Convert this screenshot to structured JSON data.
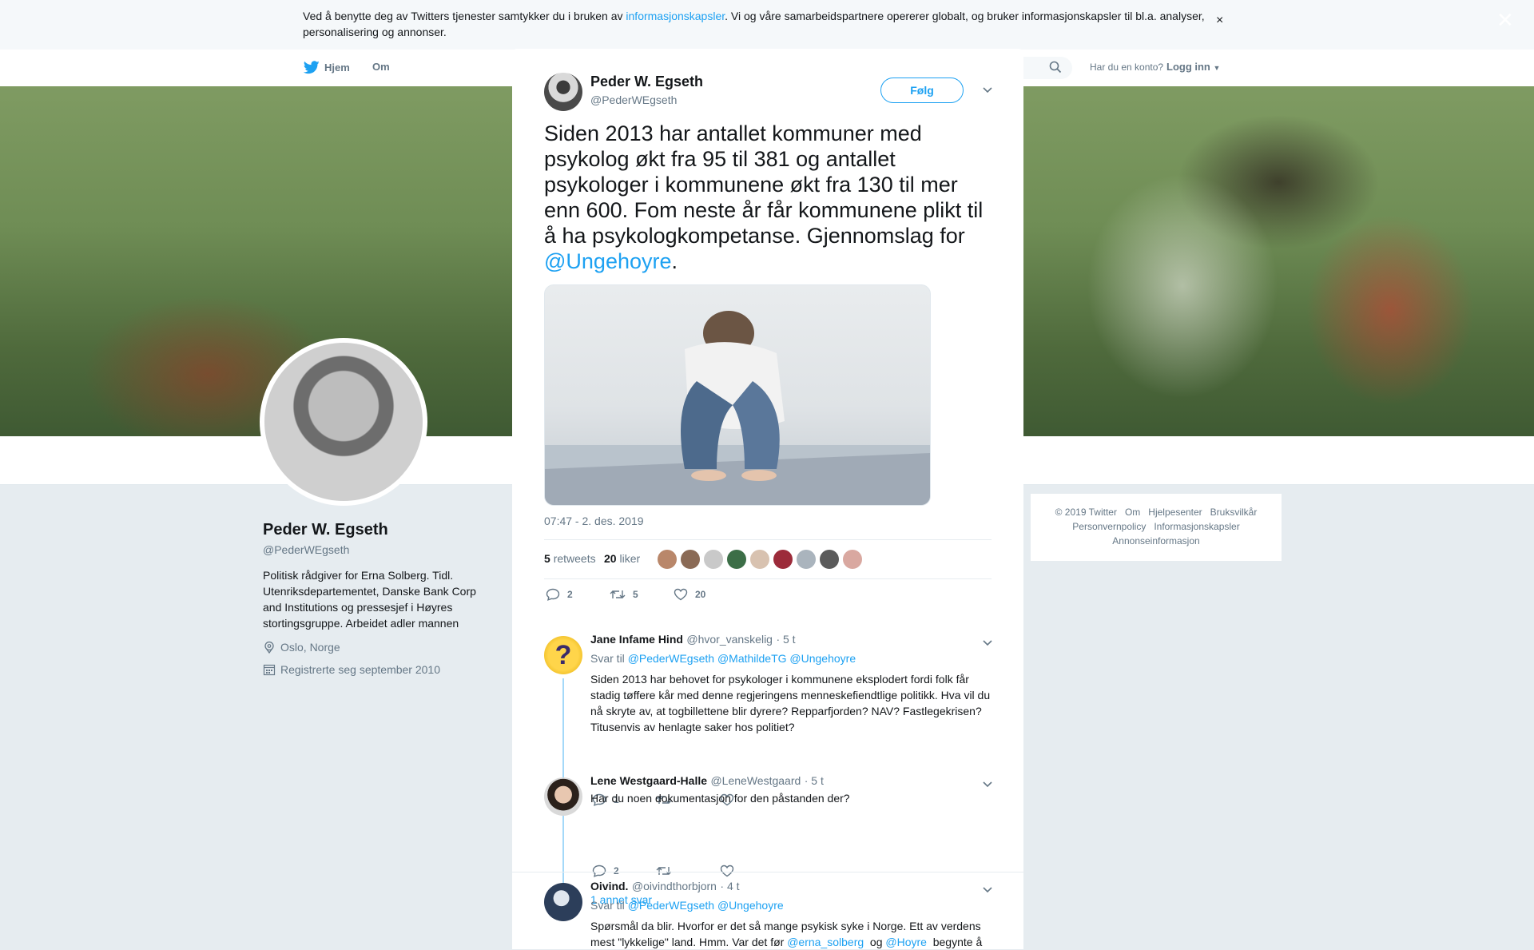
{
  "cookie_banner": {
    "text_before": "Ved å benytte deg av Twitters tjenester samtykker du i bruken av ",
    "link": "informasjonskapsler",
    "text_after": ". Vi og våre samarbeidspartnere opererer globalt, og bruker informasjonskapsler til bl.a. analyser, personalisering og annonser.",
    "close": "×"
  },
  "nav": {
    "home": "Hjem",
    "about": "Om",
    "account_question": "Har du en konto?",
    "login": "Logg inn"
  },
  "overlay_close": "✕",
  "profile": {
    "name": "Peder W. Egseth",
    "handle": "@PederWEgseth",
    "bio": "Politisk rådgiver for Erna Solberg. Tidl. Utenriksdepartementet, Danske Bank Corp and Institutions og pressesjef i Høyres stortingsgruppe. Arbeidet adler mannen",
    "location": "Oslo, Norge",
    "joined": "Registrerte seg september 2010"
  },
  "footer": {
    "links": [
      "© 2019 Twitter",
      "Om",
      "Hjelpesenter",
      "Bruksvilkår",
      "Personvernpolicy",
      "Informasjonskapsler",
      "Annonseinformasjon"
    ]
  },
  "tweet": {
    "author_name": "Peder W. Egseth",
    "author_handle": "@PederWEgseth",
    "follow": "Følg",
    "text_main": "Siden 2013 har antallet kommuner med psykolog økt fra 95 til 381 og antallet psykologer i kommunene økt fra 130 til mer enn 600. Fom neste år får kommunene plikt til å ha psykologkompetanse. Gjennomslag for ",
    "text_mention": "@Ungehoyre",
    "text_end": ".",
    "timestamp": "07:47 - 2. des. 2019",
    "retweets_count": "5",
    "retweets_label": "retweets",
    "likes_count": "20",
    "likes_label": "liker",
    "actions": {
      "replies": "2",
      "retweets": "5",
      "likes": "20"
    },
    "liker_colors": [
      "#b9876a",
      "#8a6a55",
      "#c9c9c9",
      "#3c6e47",
      "#d8c2b0",
      "#9c2b3a",
      "#aab4bd",
      "#5b5b5b",
      "#d9a8a0"
    ]
  },
  "replies": [
    {
      "name": "Jane Infame Hind",
      "handle": "@hvor_vanskelig",
      "time": "· 5 t",
      "reply_to_label": "Svar til",
      "reply_to": "@PederWEgseth @MathildeTG @Ungehoyre",
      "body": "Siden 2013 har behovet for psykologer i kommunene eksplodert fordi folk får stadig tøffere kår med denne regjeringens menneskefiendtlige politikk. Hva vil du nå skryte av, at togbillettene blir dyrere? Repparfjorden? NAV? Fastlegekrisen? Titusenvis av henlagte saker hos politiet?",
      "reply_count": "1",
      "avatar_glyph": "?"
    },
    {
      "name": "Lene Westgaard-Halle",
      "handle": "@LeneWestgaard",
      "time": "· 5 t",
      "body": "Har du noen dokumentasjon for den påstanden der?",
      "reply_count": "2"
    },
    {
      "name": "Oivind.",
      "handle": "@oivindthorbjorn",
      "time": "· 4 t",
      "reply_to_label": "Svar til",
      "reply_to": "@PederWEgseth @Ungehoyre",
      "body_start": "Spørsmål da blir. Hvorfor er det så mange psykisk syke i Norge. Ett av verdens mest \"lykkelige\" land. Hmm. Var det før ",
      "mention1": "@erna_solberg",
      "body_mid": "  og ",
      "mention2": "@Hoyre",
      "body_end": "  begynte å"
    }
  ],
  "more_replies": "1 annet svar",
  "colors": {
    "accent": "#1da1f2",
    "thread_line": "#a4d9f9",
    "muted": "#657786"
  }
}
